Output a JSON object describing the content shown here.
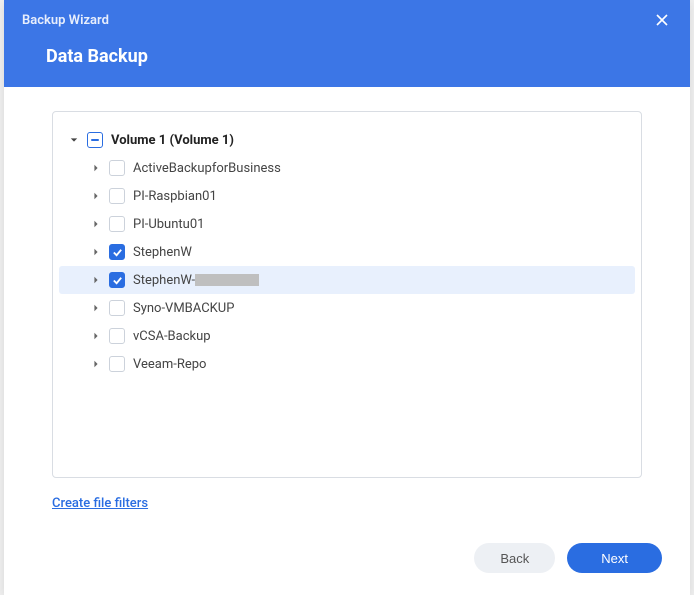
{
  "header": {
    "title": "Backup Wizard",
    "subtitle": "Data Backup"
  },
  "tree": {
    "root": {
      "label": "Volume 1 (Volume 1)",
      "state": "indeterminate",
      "expanded": true
    },
    "items": [
      {
        "label": "ActiveBackupforBusiness",
        "state": "unchecked",
        "highlighted": false
      },
      {
        "label": "PI-Raspbian01",
        "state": "unchecked",
        "highlighted": false
      },
      {
        "label": "PI-Ubuntu01",
        "state": "unchecked",
        "highlighted": false
      },
      {
        "label": "StephenW",
        "state": "checked",
        "highlighted": false
      },
      {
        "label": "StephenW-",
        "state": "checked",
        "highlighted": true,
        "redacted_suffix": true
      },
      {
        "label": "Syno-VMBACKUP",
        "state": "unchecked",
        "highlighted": false
      },
      {
        "label": "vCSA-Backup",
        "state": "unchecked",
        "highlighted": false
      },
      {
        "label": "Veeam-Repo",
        "state": "unchecked",
        "highlighted": false
      }
    ]
  },
  "link": {
    "create_filters": "Create file filters"
  },
  "footer": {
    "back": "Back",
    "next": "Next"
  }
}
